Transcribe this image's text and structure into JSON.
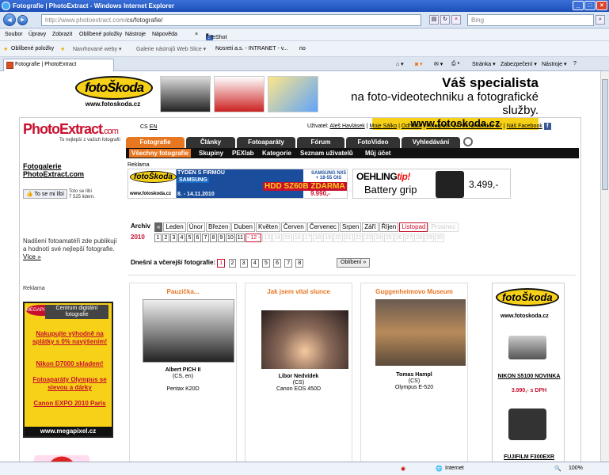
{
  "browser": {
    "title": "Fotografie | PhotoExtract - Windows Internet Explorer",
    "url_prefix": "http://www.photoextract.com/",
    "url_rest": "cs/fotografie/",
    "search_placeholder": "Bing",
    "menu": [
      "Soubor",
      "Úpravy",
      "Zobrazit",
      "Oblíbené položky",
      "Nástroje",
      "Nápověda"
    ],
    "fireshot": "FireShot",
    "favorites_label": "Oblíbené položky",
    "favorites_items": [
      "Navrhované weby ▾",
      "Galerie nástrojů Web Slice ▾",
      "Nosreti a.s. - INTRANET - v...",
      "no"
    ],
    "tab_title": "Fotografie | PhotoExtract",
    "tools": [
      "Stránka ▾",
      "Zabezpečení ▾",
      "Nástroje ▾"
    ],
    "status_zone": "Internet",
    "zoom": "100%"
  },
  "banner": {
    "logo": "fotoŠkoda",
    "logo_url": "www.fotoskoda.cz",
    "line1": "Váš specialista",
    "line2": "na foto-videotechniku a fotografické služby.",
    "url": "www.fotoskoda.cz"
  },
  "site": {
    "logo": "PhotoExtract",
    "logo_tld": ".com",
    "tagline": "To nejlepší z vašich fotografií",
    "lang_cs": "CS",
    "lang_en": "EN",
    "user_label": "Uživatel:",
    "user_name": "Aleš Havlásek",
    "links": [
      "Moje Sálko",
      "Odhlásit",
      "Fotografií: 14706, prozedáí: 57",
      "Náš Facebook"
    ],
    "nav": [
      "Fotografie",
      "Články",
      "Fotoaparáty",
      "Fórum",
      "FotoVideo",
      "Vyhledávání"
    ],
    "subnav": [
      "Všechny fotografie",
      "Skupiny",
      "PEXlab",
      "Kategorie",
      "Seznam uživatelů",
      "Můj účet"
    ]
  },
  "left": {
    "gallery_title_1": "Fotogalerie",
    "gallery_title_2": "PhotoExtract.com",
    "like_button": "To se mi líbí",
    "like_count_1": "Toto se líbí",
    "like_count_2": "7 525 lidem.",
    "desc": "Nadšení fotoamatéři zde publikují a hodnotí své nejlepší fotografie.",
    "more": "Více »",
    "reklama": "Reklama",
    "megapixel": {
      "logo": "MEGAPIXEL.CZ",
      "head": "Centrum digitální fotografie",
      "links": [
        "Nakupujte výhodně na splátky s 0% navýšením!",
        "Nikon D7000 skladem!",
        "Fotoaparáty Olympus se slevou a dárky",
        "Canon EXPO 2010 Paris"
      ],
      "foot": "www.megapixel.cz"
    }
  },
  "main": {
    "reklama": "Reklama",
    "ad_skoda": {
      "logo": "fotoŠkoda",
      "week": "TÝDEN S FIRMOU",
      "brand": "SAMSUNG",
      "promo": "HDD SZ60B ZDARMA",
      "lens": "SAMSUNG NX5 + 18-55 OIS",
      "price": "9.990,-",
      "url": "www.fotoskoda.cz",
      "dates": "8. - 14.11.2010"
    },
    "ad_oehling": {
      "brand": "OEHLING",
      "tip": "tip!",
      "product": "Battery grip",
      "price": "3.499,-"
    },
    "archive_label": "Archiv",
    "months": [
      "«",
      "Leden",
      "Únor",
      "Březen",
      "Duben",
      "Květen",
      "Červen",
      "Červenec",
      "Srpen",
      "Září",
      "Říjen",
      "Listopad",
      "Prosinec"
    ],
    "year": "2010",
    "days": [
      "1",
      "2",
      "3",
      "4",
      "5",
      "6",
      "7",
      "8",
      "9",
      "10",
      "11",
      "- 12 -",
      "13",
      "14",
      "15",
      "16",
      "17",
      "18",
      "19",
      "20",
      "21",
      "22",
      "23",
      "24",
      "25",
      "26",
      "27",
      "28",
      "29",
      "30"
    ],
    "photos_label": "Dnešní a včerejší fotografie:",
    "pages": [
      "1",
      "2",
      "3",
      "4",
      "5",
      "6",
      "7",
      "8"
    ],
    "oblibene": "Oblíbení »",
    "cards": [
      {
        "title": "Pauzička...",
        "author": "Albert PICH II",
        "country": "(CS, en)",
        "camera": "Pentax K20D"
      },
      {
        "title": "Jak jsem vítal slunce",
        "author": "Libor Nedvídek",
        "country": "(CS)",
        "camera": "Canon EOS 450D"
      },
      {
        "title": "Guggenheimovo Museum",
        "author": "Tomas Hampl",
        "country": "(CS)",
        "camera": "Olympus E-520"
      }
    ],
    "right_ad": {
      "logo": "fotoŠkoda",
      "url": "www.fotoskoda.cz",
      "product1": "NIKON S5100 NOVINKA",
      "price1": "3.990,- s DPH",
      "product2": "FUJIFILM F300EXR"
    }
  }
}
